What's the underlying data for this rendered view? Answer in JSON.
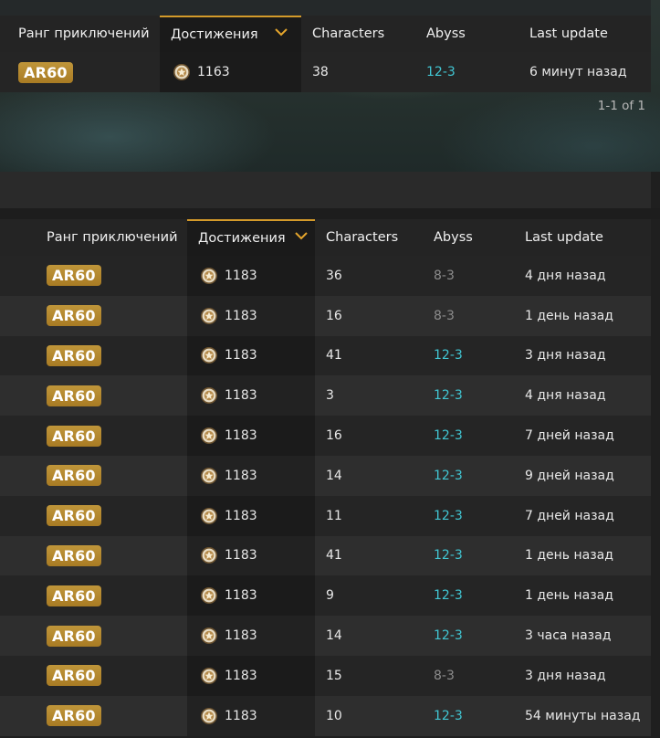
{
  "columns": {
    "rank": "Ранг приключений",
    "achievements": "Достижения",
    "characters": "Characters",
    "abyss": "Abyss",
    "last_update": "Last update"
  },
  "sort_icon": "chevron-down-icon",
  "medal_icon": "achievement-medal-icon",
  "colors": {
    "accent": "#d49a2a",
    "badge": "#b58a2e",
    "abyss_cleared": "#41c6d3",
    "abyss_partial": "#8c8c8c"
  },
  "top_table": {
    "rows": [
      {
        "rank": "AR60",
        "achievements": "1163",
        "characters": "38",
        "abyss": "12-3",
        "last_update": "6 минут назад",
        "abyss_full": true
      }
    ],
    "pagination": "1-1 of 1"
  },
  "main_table": {
    "rows": [
      {
        "rank": "AR60",
        "achievements": "1183",
        "characters": "36",
        "abyss": "8-3",
        "last_update": "4 дня назад",
        "abyss_full": false
      },
      {
        "rank": "AR60",
        "achievements": "1183",
        "characters": "16",
        "abyss": "8-3",
        "last_update": "1 день назад",
        "abyss_full": false
      },
      {
        "rank": "AR60",
        "achievements": "1183",
        "characters": "41",
        "abyss": "12-3",
        "last_update": "3 дня назад",
        "abyss_full": true
      },
      {
        "rank": "AR60",
        "achievements": "1183",
        "characters": "3",
        "abyss": "12-3",
        "last_update": "4 дня назад",
        "abyss_full": true
      },
      {
        "rank": "AR60",
        "achievements": "1183",
        "characters": "16",
        "abyss": "12-3",
        "last_update": "7 дней назад",
        "abyss_full": true
      },
      {
        "rank": "AR60",
        "achievements": "1183",
        "characters": "14",
        "abyss": "12-3",
        "last_update": "9 дней назад",
        "abyss_full": true
      },
      {
        "rank": "AR60",
        "achievements": "1183",
        "characters": "11",
        "abyss": "12-3",
        "last_update": "7 дней назад",
        "abyss_full": true
      },
      {
        "rank": "AR60",
        "achievements": "1183",
        "characters": "41",
        "abyss": "12-3",
        "last_update": "1 день назад",
        "abyss_full": true
      },
      {
        "rank": "AR60",
        "achievements": "1183",
        "characters": "9",
        "abyss": "12-3",
        "last_update": "1 день назад",
        "abyss_full": true
      },
      {
        "rank": "AR60",
        "achievements": "1183",
        "characters": "14",
        "abyss": "12-3",
        "last_update": "3 часа назад",
        "abyss_full": true
      },
      {
        "rank": "AR60",
        "achievements": "1183",
        "characters": "15",
        "abyss": "8-3",
        "last_update": "3 дня назад",
        "abyss_full": false
      },
      {
        "rank": "AR60",
        "achievements": "1183",
        "characters": "10",
        "abyss": "12-3",
        "last_update": "54 минуты назад",
        "abyss_full": true
      }
    ]
  }
}
